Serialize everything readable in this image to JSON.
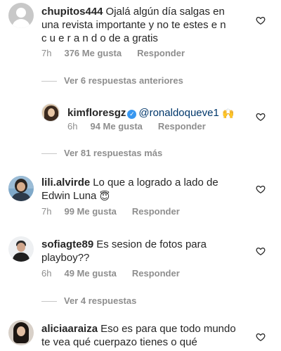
{
  "comments": [
    {
      "username": "chupitos444",
      "text_line1": "Ojalá algún día salgas en",
      "text_line2": "una revista importante y no te estes e n",
      "text_line3": "c u e r a n d o de a gratis",
      "time": "7h",
      "likes": "376 Me gusta",
      "reply": "Responder",
      "avatar_icon": "default-avatar-icon"
    },
    {
      "username": "kimfloresgz",
      "verified": true,
      "mention": "@ronaldoqueve1",
      "emoji": "🙌",
      "time": "6h",
      "likes": "94 Me gusta",
      "reply": "Responder"
    },
    {
      "username": "lili.alvirde",
      "text_line1": "Lo que a logrado a lado de",
      "text_line2": "Edwin Luna",
      "emoji": "😇",
      "time": "7h",
      "likes": "99 Me gusta",
      "reply": "Responder"
    },
    {
      "username": "sofiagte89",
      "text_line1": "Es sesion de fotos para",
      "text_line2": "playboy??",
      "time": "6h",
      "likes": "49 Me gusta",
      "reply": "Responder"
    },
    {
      "username": "aliciaaraiza",
      "text_line1": "Eso es para que todo mundo",
      "text_line2": "te vea qué cuerpazo tienes o qué"
    }
  ],
  "view_replies": {
    "previous": "Ver 6 respuestas anteriores",
    "more": "Ver 81 respuestas más",
    "four": "Ver 4 respuestas"
  },
  "colors": {
    "text": "#262626",
    "secondary": "#8e8e8e",
    "mention": "#00376b",
    "verified": "#3897f0"
  }
}
